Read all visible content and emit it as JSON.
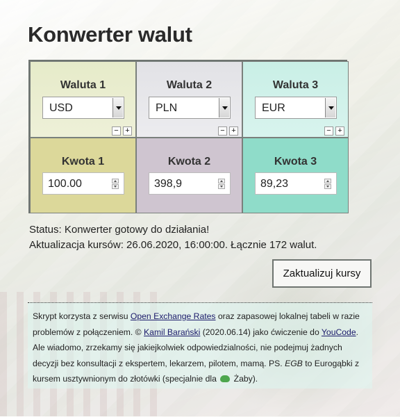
{
  "page": {
    "title": "Konwerter walut"
  },
  "currencies": [
    {
      "label": "Waluta 1",
      "value": "USD"
    },
    {
      "label": "Waluta 2",
      "value": "PLN"
    },
    {
      "label": "Waluta 3",
      "value": "EUR"
    }
  ],
  "amounts": [
    {
      "label": "Kwota 1",
      "value": "100.00"
    },
    {
      "label": "Kwota 2",
      "value": "398,9"
    },
    {
      "label": "Kwota 3",
      "value": "89,23"
    }
  ],
  "controls": {
    "minus": "−",
    "plus": "+"
  },
  "status": {
    "line1": "Status: Konwerter gotowy do działania!",
    "line2": "Aktualizacja kursów: 26.06.2020, 16:00:00. Łącznie 172 walut."
  },
  "update_button": "Zaktualizuj kursy",
  "footer": {
    "t1": "Skrypt korzysta z serwisu ",
    "link_oer": "Open Exchange Rates",
    "t2": " oraz zapasowej lokalnej tabeli w razie problemów z połączeniem. © ",
    "link_author": "Kamil Barański",
    "t3": " (2020.06.14) jako ćwiczenie do ",
    "link_youcode": "YouCode",
    "t4": ". Ale wiadomo, zrzekamy się jakiejkolwiek odpowiedzialności, nie podejmuj żadnych decyzji bez konsultacji z ekspertem, lekarzem, pilotem, mamą. PS. ",
    "egb": "EGB",
    "t5": " to Eurogąbki z kursem usztywnionym do złotówki (specjalnie dla ",
    "t6": " Żaby).",
    "frog_icon": "frog-icon"
  }
}
